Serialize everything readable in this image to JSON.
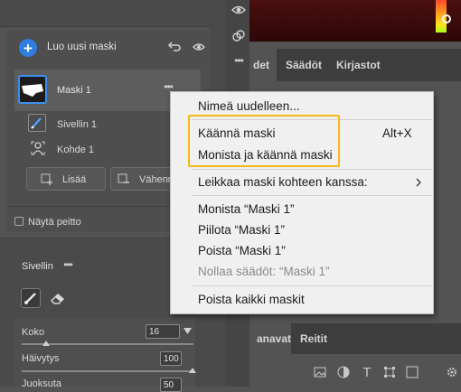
{
  "mask_panel": {
    "new_mask_label": "Luo uusi maski",
    "mask_name": "Maski 1",
    "sub_items": [
      {
        "label": "Sivellin 1",
        "icon": "brush-icon"
      },
      {
        "label": "Kohde 1",
        "icon": "subject-icon"
      }
    ],
    "add_label": "Lisää",
    "subtract_label": "Vähenn",
    "show_overlay_label": "Näytä peitto"
  },
  "brush": {
    "title": "Sivellin",
    "size_label": "Koko",
    "size_value": "16",
    "feather_label": "Häivytys",
    "feather_value": "100",
    "flow_label": "Juoksuta",
    "flow_value": "50"
  },
  "right_panel": {
    "tabs_top": [
      "det",
      "Säädöt",
      "Kirjastot"
    ],
    "tabs_bottom": [
      "anavat",
      "Reitit"
    ]
  },
  "context_menu": {
    "rename": "Nimeä uudelleen...",
    "invert": "Käännä maski",
    "invert_shortcut": "Alt+X",
    "duplicate_invert": "Monista ja käännä maski",
    "intersect": "Leikkaa maski kohteen kanssa:",
    "duplicate": "Monista “Maski 1”",
    "hide": "Piilota “Maski 1”",
    "delete": "Poista “Maski 1”",
    "reset": "Nollaa säädöt: “Maski 1”",
    "delete_all": "Poista kaikki maskit"
  },
  "colors": {
    "accent_blue": "#2f7de1",
    "highlight_yellow": "#f6b71a"
  }
}
